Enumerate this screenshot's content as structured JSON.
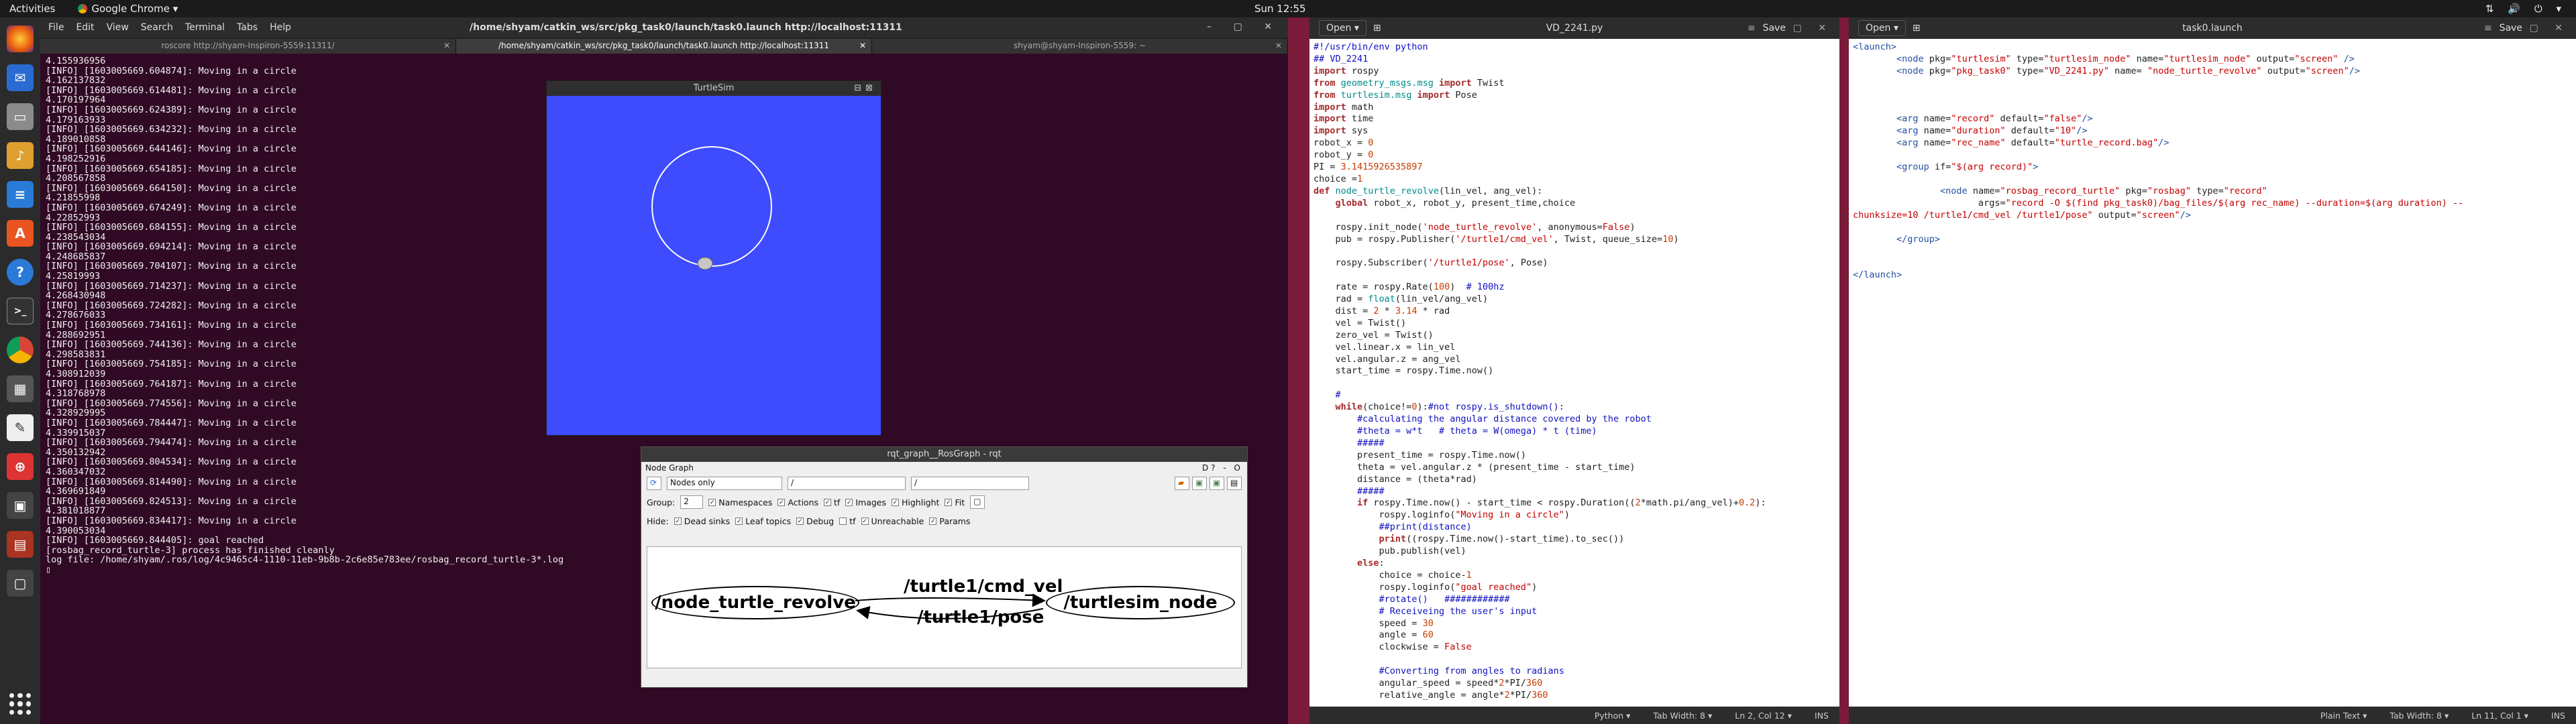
{
  "topbar": {
    "activities": "Activities",
    "app": "Google Chrome ▾",
    "clock": "Sun 12:55"
  },
  "terminal": {
    "menu": [
      "File",
      "Edit",
      "View",
      "Search",
      "Terminal",
      "Tabs",
      "Help"
    ],
    "path": "/home/shyam/catkin_ws/src/pkg_task0/launch/task0.launch http://localhost:11311",
    "tabs": [
      "roscore http://shyam-Inspiron-5559:11311/",
      "/home/shyam/catkin_ws/src/pkg_task0/launch/task0.launch http://localhost:11311",
      "shyam@shyam-Inspiron-5559: ~"
    ],
    "log": "4.155936956\n[INFO] [1603005669.604874]: Moving in a circle\n4.162137832\n[INFO] [1603005669.614481]: Moving in a circle\n4.170197964\n[INFO] [1603005669.624389]: Moving in a circle\n4.179163933\n[INFO] [1603005669.634232]: Moving in a circle\n4.189010858\n[INFO] [1603005669.644146]: Moving in a circle\n4.198252916\n[INFO] [1603005669.654185]: Moving in a circle\n4.208567858\n[INFO] [1603005669.664150]: Moving in a circle\n4.21855998\n[INFO] [1603005669.674249]: Moving in a circle\n4.22852993\n[INFO] [1603005669.684155]: Moving in a circle\n4.238543034\n[INFO] [1603005669.694214]: Moving in a circle\n4.248685837\n[INFO] [1603005669.704107]: Moving in a circle\n4.25819993\n[INFO] [1603005669.714237]: Moving in a circle\n4.268430948\n[INFO] [1603005669.724282]: Moving in a circle\n4.278676033\n[INFO] [1603005669.734161]: Moving in a circle\n4.288692951\n[INFO] [1603005669.744136]: Moving in a circle\n4.298583831\n[INFO] [1603005669.754185]: Moving in a circle\n4.308912039\n[INFO] [1603005669.764187]: Moving in a circle\n4.318768978\n[INFO] [1603005669.774556]: Moving in a circle\n4.328929995\n[INFO] [1603005669.784447]: Moving in a circle\n4.339915037\n[INFO] [1603005669.794474]: Moving in a circle\n4.350132942\n[INFO] [1603005669.804534]: Moving in a circle\n4.360347032\n[INFO] [1603005669.814490]: Moving in a circle\n4.369691849\n[INFO] [1603005669.824513]: Moving in a circle\n4.381018877\n[INFO] [1603005669.834417]: Moving in a circle\n4.390053034\n[INFO] [1603005669.844405]: goal reached\n[rosbag_record_turtle-3] process has finished cleanly\nlog file: /home/shyam/.ros/log/4c9465c4-1110-11eb-9b8b-2c6e85e783ee/rosbag_record_turtle-3*.log\n▯"
  },
  "turtlesim": {
    "title": "TurtleSim"
  },
  "rqt": {
    "title": "rqt_graph__RosGraph - rqt",
    "panel": "Node Graph",
    "mode": "Nodes only",
    "ns_filter": "/",
    "topic_filter": "/",
    "group_label": "Group:",
    "group_value": "2",
    "row2": [
      "Namespaces",
      "Actions",
      "tf",
      "Images",
      "Highlight",
      "Fit"
    ],
    "hide_label": "Hide:",
    "row3": [
      "Dead sinks",
      "Leaf topics",
      "Debug",
      "tf",
      "Unreachable",
      "Params"
    ],
    "nodes": [
      "/node_turtle_revolve",
      "/turtlesim_node"
    ],
    "edges": [
      "/turtle1/cmd_vel",
      "/turtle1/pose"
    ]
  },
  "gedit_py": {
    "open": "Open ▾",
    "title": "VD_2241.py",
    "save": "Save",
    "status": [
      "Python ▾",
      "Tab Width: 8 ▾",
      "Ln 2, Col 12 ▾",
      "INS"
    ]
  },
  "gedit_launch": {
    "open": "Open ▾",
    "title": "task0.launch",
    "save": "Save",
    "status": [
      "Plain Text ▾",
      "Tab Width: 8 ▾",
      "Ln 11, Col 1 ▾",
      "INS"
    ]
  }
}
